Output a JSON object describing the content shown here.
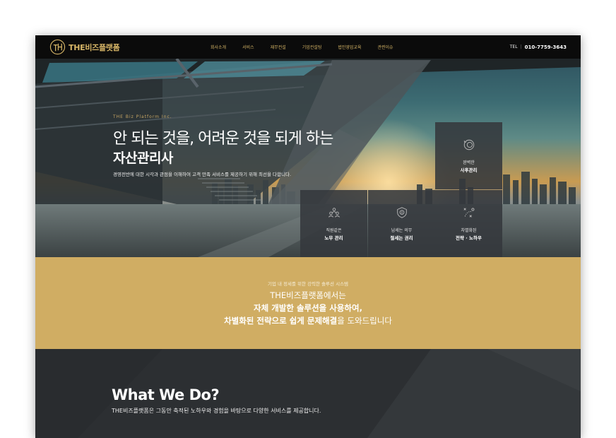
{
  "header": {
    "logo_text": "THE비즈플랫폼",
    "nav": [
      "회사소개",
      "서비스",
      "재무컨설",
      "기업컨설팅",
      "법인영업교육",
      "관련이슈"
    ],
    "tel_label": "TEL",
    "tel_number": "010-7759-3643"
  },
  "hero": {
    "eyebrow": "THE Biz Platform Inc.",
    "title": "안 되는 것을, 어려운 것을 되게 하는",
    "subtitle": "자산관리사",
    "description": "경영전반에 대한 시각과 관점을 이해하여 고객 만족 서비스를 제공하기 위해 최선을 다합니다.",
    "cards": [
      {
        "icon": "coin-cycle-icon",
        "line1": "완벽한",
        "line2": "사후관리"
      },
      {
        "icon": "people-icon",
        "line1": "직원같은",
        "line2": "노무 관리"
      },
      {
        "icon": "money-shield-icon",
        "line1": "납세는 의무",
        "line2": "절세는 권리"
      },
      {
        "icon": "strategy-icon",
        "line1": "차별화된",
        "line2": "전략 · 노하우"
      }
    ]
  },
  "gold": {
    "eyebrow": "기업 내 정세를 위한 강력한 솔루션 시스템",
    "line1": "THE비즈플랫폼에서는",
    "line2": "자체 개발한 솔루션을 사용하여,",
    "line3_bold": "차별화된 전략으로 쉽게 문제해결",
    "line3_rest": "을 도와드립니다"
  },
  "what_we_do": {
    "title": "What We Do?",
    "description": "THE비즈플랫폼은 그동안 축적된 노하우와 경험을 바탕으로 다양한 서비스를 제공합니다."
  },
  "colors": {
    "gold": "#d0ad63",
    "logo_gold": "#d7b667",
    "header_bg": "#0b0b0b",
    "dark_bg": "#2c2f32"
  }
}
